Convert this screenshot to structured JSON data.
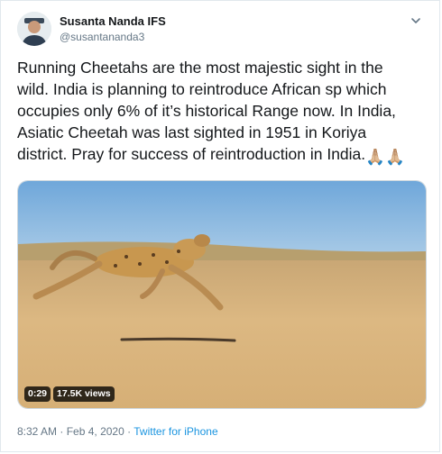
{
  "author": {
    "name": "Susanta Nanda IFS",
    "handle": "@susantananda3"
  },
  "tweet": {
    "text_lines": [
      "Running Cheetahs are the most majestic sight  in the",
      "wild. India is planning to reintroduce African sp which",
      "occupies only 6% of it’s historical Range now. In India,",
      "Asiatic Cheetah was last sighted in 1951 in Koriya",
      "district. Pray for success of reintroduction in India."
    ],
    "emojis": [
      "🙏🏼",
      "🙏🏼"
    ]
  },
  "media": {
    "duration": "0:29",
    "views": "17.5K views"
  },
  "footer": {
    "time": "8:32 AM",
    "separator": "·",
    "date": "Feb 4, 2020",
    "source": "Twitter for iPhone"
  },
  "colors": {
    "text": "#14171a",
    "muted": "#657786",
    "link": "#1b95e0",
    "sky": "#7fb0dd",
    "sand": "#d8b27a"
  }
}
